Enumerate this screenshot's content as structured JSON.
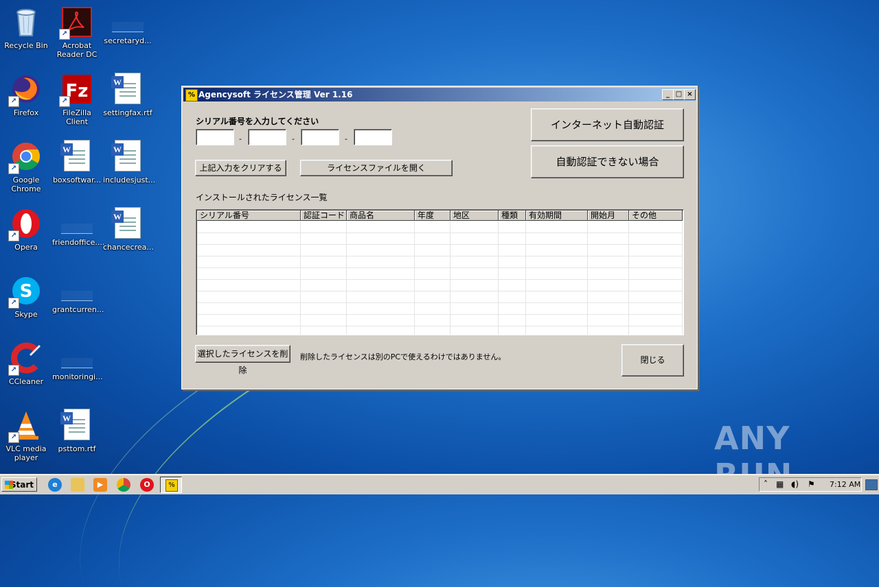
{
  "desktop": {
    "icons": [
      {
        "label": "Recycle Bin"
      },
      {
        "label": "Acrobat Reader DC"
      },
      {
        "label": "secretaryd..."
      },
      {
        "label": "Firefox"
      },
      {
        "label": "FileZilla Client"
      },
      {
        "label": "settingfax.rtf"
      },
      {
        "label": "Google Chrome"
      },
      {
        "label": "boxsoftwar..."
      },
      {
        "label": "includesjust..."
      },
      {
        "label": "Opera"
      },
      {
        "label": "friendoffice...."
      },
      {
        "label": "chancecrea..."
      },
      {
        "label": "Skype"
      },
      {
        "label": "grantcurren..."
      },
      {
        "label": "CCleaner"
      },
      {
        "label": "monitoringi..."
      },
      {
        "label": "VLC media player"
      },
      {
        "label": "psttom.rtf"
      }
    ]
  },
  "window": {
    "title": "Agencysoft ライセンス管理 Ver 1.16",
    "controls": {
      "minimize": "_",
      "maximize": "□",
      "close": "×"
    },
    "serial_prompt": "シリアル番号を入力してください",
    "serial_fields": [
      "",
      "",
      "",
      ""
    ],
    "serial_separator": "-",
    "clear_button": "上記入力をクリアする",
    "open_license_file_button": "ライセンスファイルを開く",
    "internet_auth_button": "インターネット自動認証",
    "manual_auth_button": "自動認証できない場合",
    "installed_label": "インストールされたライセンス一覧",
    "table": {
      "columns": [
        "シリアル番号",
        "認証コード",
        "商品名",
        "年度",
        "地区",
        "種類",
        "有効期間",
        "開始月",
        "その他"
      ],
      "rows": []
    },
    "delete_button": "選択したライセンスを削除",
    "delete_note": "削除したライセンスは別のPCで使えるわけではありません。",
    "close_button": "閉じる"
  },
  "taskbar": {
    "start_label": "Start",
    "clock": "7:12 AM"
  },
  "watermark": "ANY RUN"
}
